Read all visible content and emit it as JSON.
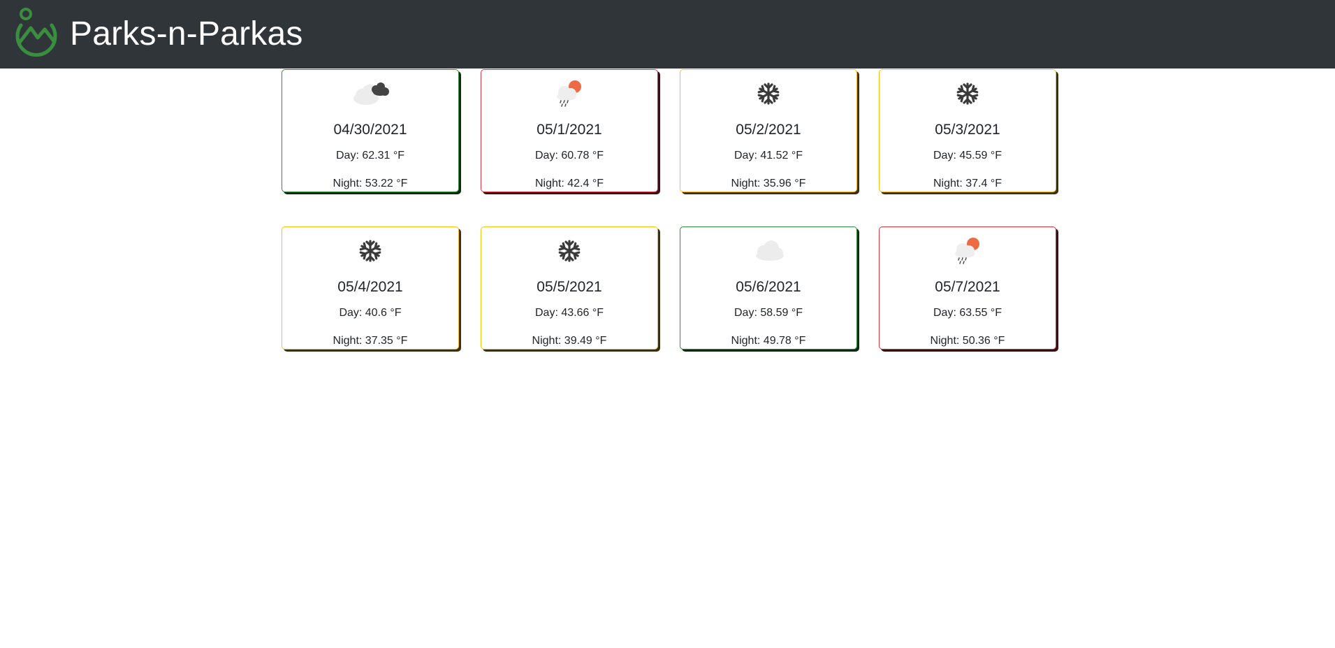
{
  "header": {
    "brand": "Parks-n-Parkas",
    "brand_color": "#ffffff",
    "background": "#30353a",
    "logo_color": "#3a8f3f",
    "logo_icon": "mountain-pin-logo-icon"
  },
  "forecast": [
    {
      "date": "04/30/2021",
      "day": "Day: 62.31 °F",
      "night": "Night: 53.22 °F",
      "icon": "cloudy-dark-icon",
      "status": "green"
    },
    {
      "date": "05/1/2021",
      "day": "Day: 60.78 °F",
      "night": "Night: 42.4 °F",
      "icon": "rain-sun-icon",
      "status": "red"
    },
    {
      "date": "05/2/2021",
      "day": "Day: 41.52 °F",
      "night": "Night: 35.96 °F",
      "icon": "snowflake-icon",
      "status": "yellow"
    },
    {
      "date": "05/3/2021",
      "day": "Day: 45.59 °F",
      "night": "Night: 37.4 °F",
      "icon": "snowflake-icon",
      "status": "yellow"
    },
    {
      "date": "05/4/2021",
      "day": "Day: 40.6 °F",
      "night": "Night: 37.35 °F",
      "icon": "snowflake-icon",
      "status": "yellow"
    },
    {
      "date": "05/5/2021",
      "day": "Day: 43.66 °F",
      "night": "Night: 39.49 °F",
      "icon": "snowflake-icon",
      "status": "yellow"
    },
    {
      "date": "05/6/2021",
      "day": "Day: 58.59 °F",
      "night": "Night: 49.78 °F",
      "icon": "cloud-icon",
      "status": "green"
    },
    {
      "date": "05/7/2021",
      "day": "Day: 63.55 °F",
      "night": "Night: 50.36 °F",
      "icon": "rain-sun-icon",
      "status": "red"
    }
  ],
  "colors": {
    "green": "#2f8f3d",
    "red": "#dc3545",
    "yellow": "#ffc107"
  }
}
